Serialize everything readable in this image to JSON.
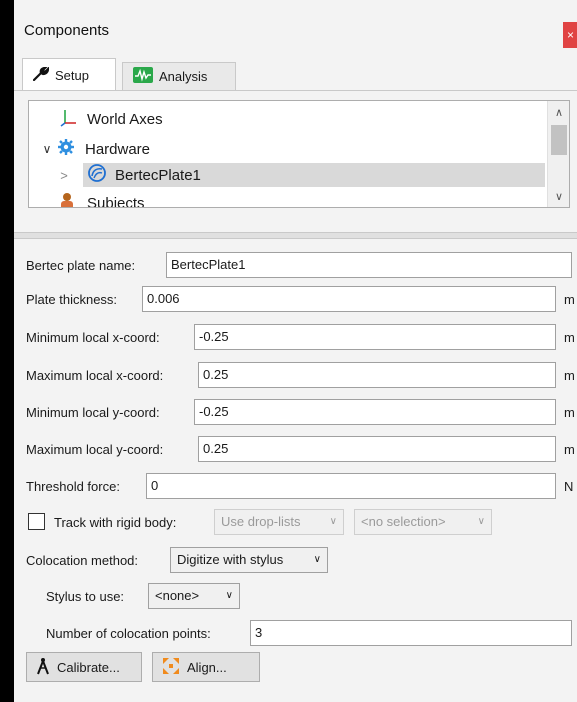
{
  "window": {
    "title": "Components",
    "close_glyph": "×"
  },
  "tabs": [
    {
      "label": "Setup",
      "icon": "wrench-icon"
    },
    {
      "label": "Analysis",
      "icon": "waveform-icon"
    }
  ],
  "tree": {
    "items": [
      {
        "label": "World Axes",
        "icon": "axes-icon"
      },
      {
        "label": "Hardware",
        "icon": "gear-icon",
        "expander": "∨"
      },
      {
        "label": "BertecPlate1",
        "icon": "forceplate-icon",
        "expander": ">"
      },
      {
        "label": "Subjects",
        "icon": "person-icon"
      }
    ]
  },
  "form": {
    "plate_name": {
      "label": "Bertec plate name:",
      "value": "BertecPlate1"
    },
    "plate_thickness": {
      "label": "Plate thickness:",
      "value": "0.006",
      "unit": "m"
    },
    "min_x": {
      "label": "Minimum local x-coord:",
      "value": "-0.25",
      "unit": "m"
    },
    "max_x": {
      "label": "Maximum local x-coord:",
      "value": "0.25",
      "unit": "m"
    },
    "min_y": {
      "label": "Minimum local y-coord:",
      "value": "-0.25",
      "unit": "m"
    },
    "max_y": {
      "label": "Maximum local y-coord:",
      "value": "0.25",
      "unit": "m"
    },
    "threshold": {
      "label": "Threshold force:",
      "value": "0",
      "unit": "N"
    },
    "track_rigid": {
      "label": "Track with rigid body:",
      "combo1": "Use drop-lists",
      "combo2": "<no selection>"
    },
    "colocation": {
      "label": "Colocation method:",
      "value": "Digitize with stylus"
    },
    "stylus": {
      "label": "Stylus to use:",
      "value": "<none>"
    },
    "num_points": {
      "label": "Number of colocation points:",
      "value": "3"
    }
  },
  "buttons": {
    "calibrate": "Calibrate...",
    "align": "Align..."
  },
  "colors": {
    "accent_green": "#2aa84a",
    "forceplate_blue": "#1f6fd1",
    "gear_blue": "#2e8fe0",
    "close_red": "#e04343"
  }
}
